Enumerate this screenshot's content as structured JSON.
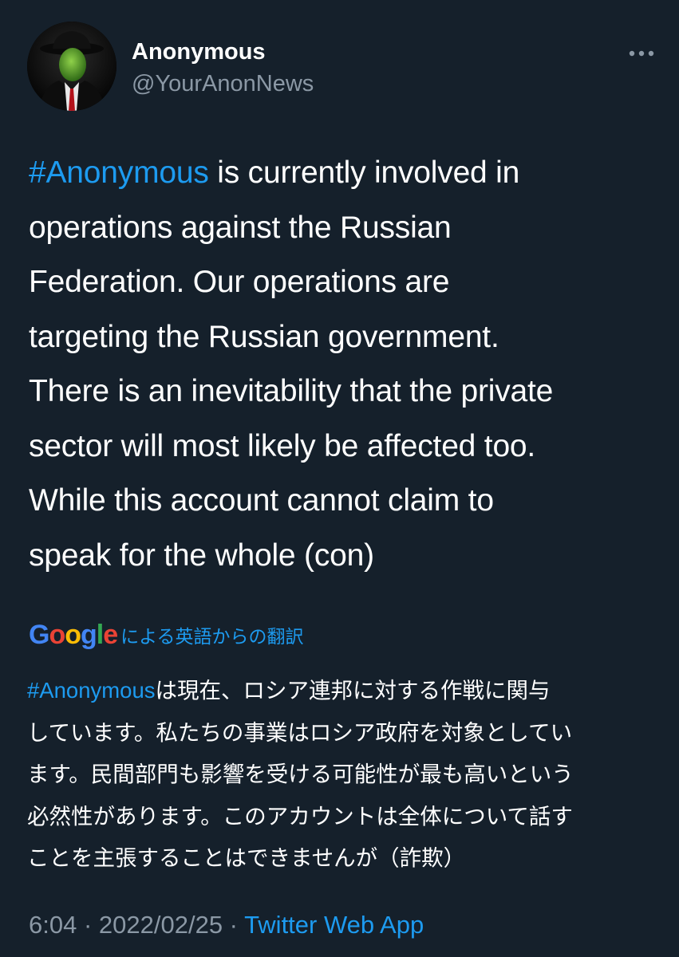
{
  "header": {
    "display_name": "Anonymous",
    "handle": "@YourAnonNews",
    "avatar_icon": "anonymous-suit-mask-avatar",
    "more_icon": "more-horizontal-icon"
  },
  "tweet": {
    "hashtag": "#Anonymous",
    "lines": {
      "l1": " is currently involved in",
      "l2": "operations against the Russian",
      "l3": "Federation. Our operations are",
      "l4": "targeting the Russian government.",
      "l5": "There is an inevitability that the private",
      "l6": "sector will most likely be affected too.",
      "l7": "While this account cannot claim to",
      "l8": "speak for the whole (con)"
    }
  },
  "translation": {
    "provider_logo": {
      "G": "G",
      "o1": "o",
      "o2": "o",
      "g": "g",
      "l": "l",
      "e": "e"
    },
    "label": "による英語からの翻訳",
    "hashtag": "#Anonymous",
    "lines": {
      "l1": "は現在、ロシア連邦に対する作戦に関与",
      "l2": "しています。私たちの事業はロシア政府を対象としてい",
      "l3": "ます。民間部門も影響を受ける可能性が最も高いという",
      "l4": "必然性があります。このアカウントは全体について話す",
      "l5": "ことを主張することはできませんが（詐欺）"
    }
  },
  "meta": {
    "time": "6:04",
    "separator": " · ",
    "date": "2022/02/25",
    "app": "Twitter Web App"
  },
  "colors": {
    "background": "#15202b",
    "text": "#ffffff",
    "secondary": "#8b98a5",
    "link": "#1d9bf0",
    "google_blue": "#4285f4",
    "google_red": "#ea4335",
    "google_yellow": "#fbbc05",
    "google_green": "#34a853"
  }
}
